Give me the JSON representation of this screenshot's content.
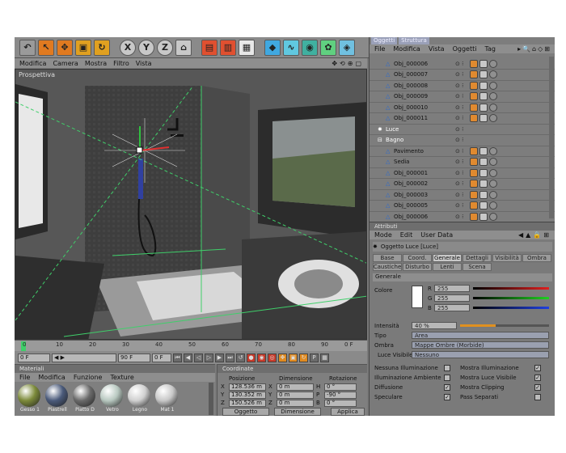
{
  "toolbar": {
    "buttons": [
      {
        "name": "undo-icon",
        "glyph": "↶"
      },
      {
        "name": "select-icon",
        "glyph": "↖"
      },
      {
        "name": "move-icon",
        "glyph": "✥"
      },
      {
        "name": "scale-icon",
        "glyph": "▣"
      },
      {
        "name": "rotate-icon",
        "glyph": "↻"
      },
      {
        "name": "x-axis-icon",
        "glyph": "X"
      },
      {
        "name": "y-axis-icon",
        "glyph": "Y"
      },
      {
        "name": "z-axis-icon",
        "glyph": "Z"
      },
      {
        "name": "coord-system-icon",
        "glyph": "⌂"
      },
      {
        "name": "render-view-icon",
        "glyph": "▤"
      },
      {
        "name": "render-picture-icon",
        "glyph": "▥"
      },
      {
        "name": "render-settings-icon",
        "glyph": "▦"
      },
      {
        "name": "cube-icon",
        "glyph": "◆"
      },
      {
        "name": "spline-icon",
        "glyph": "∿"
      },
      {
        "name": "nurbs-icon",
        "glyph": "◉"
      },
      {
        "name": "array-icon",
        "glyph": "✿"
      },
      {
        "name": "deformer-icon",
        "glyph": "◈"
      }
    ]
  },
  "viewport": {
    "menu": [
      "Modifica",
      "Camera",
      "Mostra",
      "Filtro",
      "Vista"
    ],
    "label": "Prospettiva"
  },
  "timeline": {
    "ticks": [
      "0",
      "10",
      "20",
      "30",
      "40",
      "50",
      "60",
      "70",
      "80",
      "90"
    ],
    "end_frame": "0 F",
    "start_field": "0 F",
    "end_field": "90 F",
    "current_field": "0 F"
  },
  "materials": {
    "title": "Materiali",
    "menu": [
      "File",
      "Modifica",
      "Funzione",
      "Texture"
    ],
    "items": [
      {
        "label": "Gesso 1",
        "color": "#7c8a3a"
      },
      {
        "label": "Piastrell",
        "color": "#4a5a7a"
      },
      {
        "label": "Piatto D",
        "color": "#6a6a6a"
      },
      {
        "label": "Vetro",
        "color": "#b8c8c0"
      },
      {
        "label": "Legno",
        "color": "#d0d0d0"
      },
      {
        "label": "Mat 1",
        "color": "#c8c8c8"
      }
    ]
  },
  "coordinates": {
    "title": "Coordinate",
    "headers": [
      "Posizione",
      "Dimensione",
      "Rotazione"
    ],
    "rows": [
      {
        "axis": "X",
        "pos": "128.536 m",
        "dim_axis": "X",
        "dim": "0 m",
        "rot_axis": "H",
        "rot": "0 °"
      },
      {
        "axis": "Y",
        "pos": "130.352 m",
        "dim_axis": "Y",
        "dim": "0 m",
        "rot_axis": "P",
        "rot": "-90 °"
      },
      {
        "axis": "Z",
        "pos": "150.526 m",
        "dim_axis": "Z",
        "dim": "0 m",
        "rot_axis": "B",
        "rot": "0 °"
      }
    ],
    "mode_dd": "Oggetto",
    "dim_dd": "Dimensione",
    "apply_label": "Applica"
  },
  "objects": {
    "tabs": [
      "Oggetti",
      "Struttura"
    ],
    "menu": [
      "File",
      "Modifica",
      "Vista",
      "Oggetti",
      "Tag"
    ],
    "rows": [
      {
        "name": "Obj_000006",
        "indent": 2
      },
      {
        "name": "Obj_000007",
        "indent": 2
      },
      {
        "name": "Obj_000008",
        "indent": 2
      },
      {
        "name": "Obj_000009",
        "indent": 2
      },
      {
        "name": "Obj_000010",
        "indent": 2
      },
      {
        "name": "Obj_000011",
        "indent": 2
      },
      {
        "name": "Luce",
        "indent": 1
      },
      {
        "name": "Bagno",
        "indent": 1
      },
      {
        "name": "Pavimento",
        "indent": 2
      },
      {
        "name": "Sedia",
        "indent": 2
      },
      {
        "name": "Obj_000001",
        "indent": 2
      },
      {
        "name": "Obj_000002",
        "indent": 2
      },
      {
        "name": "Obj_000003",
        "indent": 2
      },
      {
        "name": "Obj_000005",
        "indent": 2
      },
      {
        "name": "Obj_000006",
        "indent": 2
      }
    ]
  },
  "attributes": {
    "title": "Attributi",
    "menu": [
      "Mode",
      "Edit",
      "User Data"
    ],
    "object_title": "Oggetto Luce [Luce]",
    "tabs_row1": [
      "Base",
      "Coord.",
      "Generale",
      "Dettagli",
      "Visibilità",
      "Ombra"
    ],
    "tabs_row2": [
      "Caustiche",
      "Disturbo",
      "Lenti",
      "Scena"
    ],
    "section": "Generale",
    "color_label": "Colore",
    "rgb": [
      {
        "ch": "R",
        "val": "255"
      },
      {
        "ch": "G",
        "val": "255"
      },
      {
        "ch": "B",
        "val": "255"
      }
    ],
    "intensity_label": "Intensità",
    "intensity_value": "40 %",
    "intensity_fraction": 0.4,
    "type_label": "Tipo",
    "type_value": "Area",
    "shadow_label": "Ombra",
    "shadow_value": "Mappe Ombre (Morbide)",
    "visible_light_label": "Luce Visibile",
    "visible_light_value": "Nessuno",
    "checks_left": [
      {
        "label": "Nessuna Illuminazione",
        "checked": false
      },
      {
        "label": "Illuminazione Ambiente",
        "checked": false
      },
      {
        "label": "Diffusione",
        "checked": true
      },
      {
        "label": "Speculare",
        "checked": true
      }
    ],
    "checks_right": [
      {
        "label": "Mostra Illuminazione",
        "checked": true
      },
      {
        "label": "Mostra Luce Visibile",
        "checked": true
      },
      {
        "label": "Mostra Clipping",
        "checked": true
      },
      {
        "label": "Pass Separati",
        "checked": false
      }
    ]
  }
}
